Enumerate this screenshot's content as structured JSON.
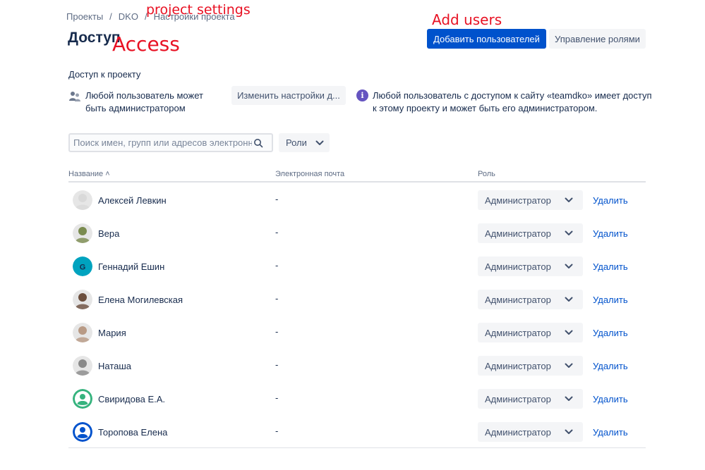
{
  "breadcrumb": [
    "Проекты",
    "DKO",
    "Настройки проекта"
  ],
  "annotations": {
    "project_settings": "project settings",
    "access": "Access",
    "add_users": "Add users"
  },
  "header": {
    "title": "Доступ",
    "add_users_label": "Добавить пользователей",
    "manage_roles_label": "Управление ролями"
  },
  "access": {
    "section_title": "Доступ к проекту",
    "permission_text": "Любой пользователь может быть администратором",
    "change_settings_label": "Изменить настройки д...",
    "info_text": "Любой пользователь с доступом к сайту «teamdko» имеет доступ к этому проекту и может быть его администратором."
  },
  "search": {
    "placeholder": "Поиск имен, групп или адресов электронной почты",
    "roles_filter_label": "Роли"
  },
  "table": {
    "columns": {
      "name": "Название ˄",
      "email": "Электронная почта",
      "role": "Роль"
    },
    "rows": [
      {
        "name": "Алексей Левкин",
        "email": "-",
        "role": "Администратор",
        "delete": "Удалить",
        "avatar": "photo",
        "avatar_color": "#d9d9d9"
      },
      {
        "name": "Вера",
        "email": "-",
        "role": "Администратор",
        "delete": "Удалить",
        "avatar": "photo",
        "avatar_color": "#7a8b4f"
      },
      {
        "name": "Геннадий Ешин",
        "email": "-",
        "role": "Администратор",
        "delete": "Удалить",
        "avatar": "initial",
        "initial": "G",
        "avatar_color": "#00a3bf"
      },
      {
        "name": "Елена Могилевская",
        "email": "-",
        "role": "Администратор",
        "delete": "Удалить",
        "avatar": "photo",
        "avatar_color": "#6b4e3d"
      },
      {
        "name": "Мария",
        "email": "-",
        "role": "Администратор",
        "delete": "Удалить",
        "avatar": "photo",
        "avatar_color": "#b89a85"
      },
      {
        "name": "Наташа",
        "email": "-",
        "role": "Администратор",
        "delete": "Удалить",
        "avatar": "photo",
        "avatar_color": "#8a8a8a"
      },
      {
        "name": "Свиридова Е.А.",
        "email": "-",
        "role": "Администратор",
        "delete": "Удалить",
        "avatar": "default",
        "avatar_color": "#36b37e"
      },
      {
        "name": "Торопова Елена",
        "email": "-",
        "role": "Администратор",
        "delete": "Удалить",
        "avatar": "default",
        "avatar_color": "#0052cc"
      }
    ]
  }
}
